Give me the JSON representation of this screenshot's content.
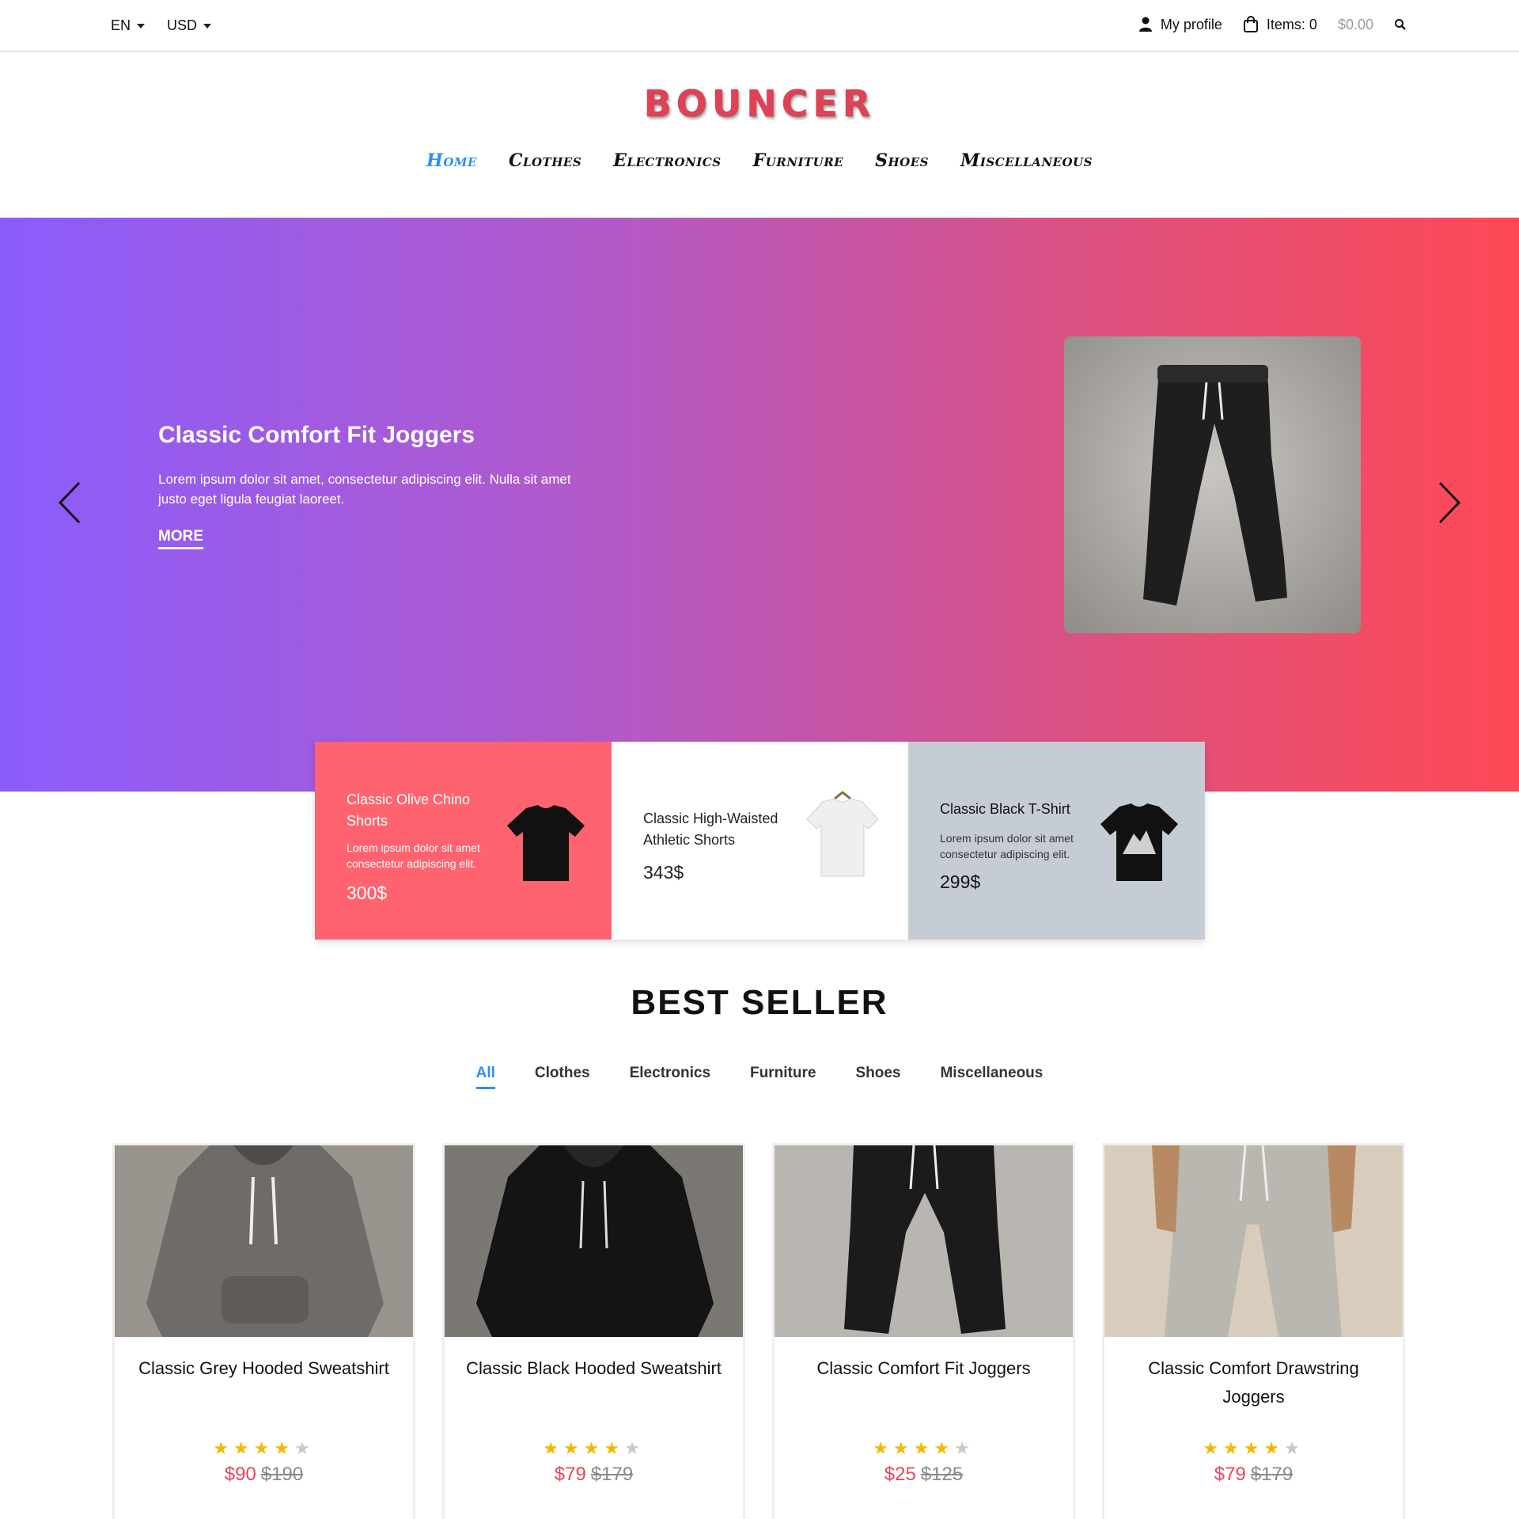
{
  "topbar": {
    "language": "EN",
    "currency": "USD",
    "profile_label": "My profile",
    "cart_items": "Items: 0",
    "cart_total": "$0.00"
  },
  "brand": {
    "logo_text": "BOUNCER",
    "accent": "#e24055"
  },
  "nav": {
    "items": [
      "Home",
      "Clothes",
      "Electronics",
      "Furniture",
      "Shoes",
      "Miscellaneous"
    ],
    "active_color": "#2e8ff0"
  },
  "hero": {
    "title": "Classic Comfort Fit Joggers",
    "text": "Lorem ipsum dolor sit amet, consectetur adipiscing elit. Nulla sit amet justo eget ligula feugiat laoreet.",
    "more_label": "MORE",
    "gradient": [
      "#8b5cfc",
      "#ff4a56"
    ]
  },
  "promos": [
    {
      "title": "Classic Olive Chino Shorts",
      "desc": "Lorem ipsum dolor sit amet consectetur adipiscing elit.",
      "price": "300$",
      "bg": "#ff636f"
    },
    {
      "title": "Classic High-Waisted Athletic Shorts",
      "desc": "",
      "price": "343$",
      "bg": "#ffffff"
    },
    {
      "title": "Classic Black T-Shirt",
      "desc": "Lorem ipsum dolor sit amet consectetur adipiscing elit.",
      "price": "299$",
      "bg": "#c6ccd3"
    }
  ],
  "best_seller": {
    "title": "BEST SELLER",
    "tabs": [
      "All",
      "Clothes",
      "Electronics",
      "Furniture",
      "Shoes",
      "Miscellaneous"
    ],
    "products": [
      {
        "name": "Classic Grey Hooded Sweatshirt",
        "rating": 4,
        "price": "$90",
        "old_price": "$190"
      },
      {
        "name": "Classic Black Hooded Sweatshirt",
        "rating": 4,
        "price": "$79",
        "old_price": "$179"
      },
      {
        "name": "Classic Comfort Fit Joggers",
        "rating": 4,
        "price": "$25",
        "old_price": "$125"
      },
      {
        "name": "Classic Comfort Drawstring Joggers",
        "rating": 4,
        "price": "$79",
        "old_price": "$179"
      }
    ]
  }
}
